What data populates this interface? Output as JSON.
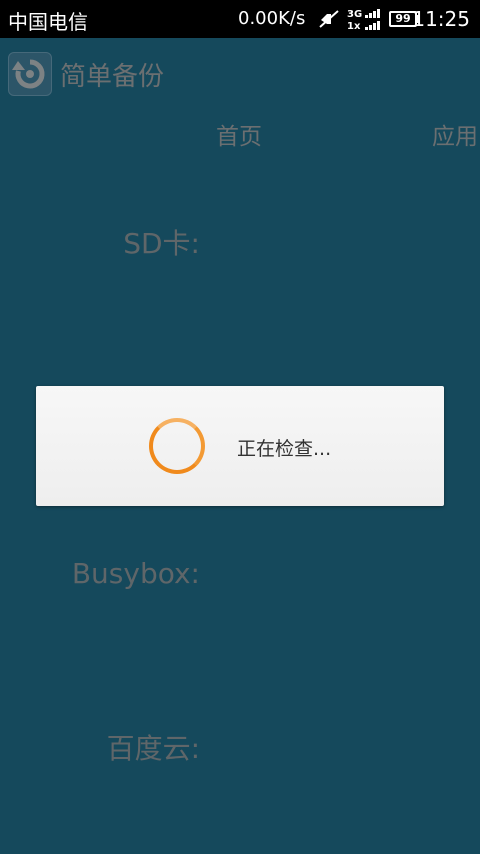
{
  "status_bar": {
    "carrier": "中国电信",
    "speed": "0.00K/s",
    "network_label": "3G 1x",
    "battery_level": "99",
    "time": "11:25"
  },
  "app": {
    "title": "简单备份",
    "icon": "restore-icon"
  },
  "tabs": [
    {
      "label": "首页"
    },
    {
      "label": "应用"
    }
  ],
  "labels": {
    "sd_card": "SD卡:",
    "busybox": "Busybox:",
    "baidu_cloud": "百度云:"
  },
  "dialog": {
    "message": "正在检查...",
    "spinner_color": "#f08a1c"
  },
  "colors": {
    "background": "#15495c",
    "status_bar": "#000000",
    "muted_text": "#6b6f71"
  }
}
